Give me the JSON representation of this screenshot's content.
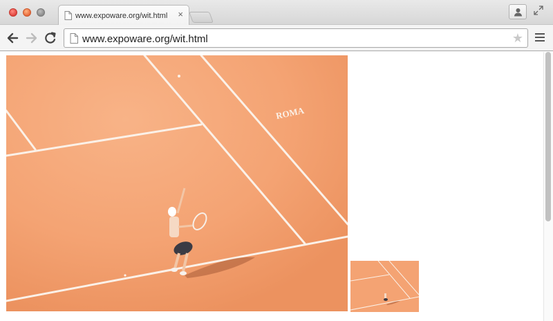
{
  "browser": {
    "tab": {
      "title": "www.expoware.org/wit.html",
      "close_glyph": "×",
      "icon": "document-icon"
    },
    "newtab_icon": "new-tab-icon",
    "profile_icon": "person-icon",
    "fullscreen_icon": "fullscreen-icon"
  },
  "toolbar": {
    "back_icon": "arrow-left-icon",
    "forward_icon": "arrow-right-icon",
    "reload_icon": "reload-icon",
    "address": "www.expoware.org/wit.html",
    "bookmark_glyph": "★",
    "menu_icon": "hamburger-menu-icon"
  },
  "page": {
    "main_image": {
      "subject": "tennis player serving on clay court",
      "court_text": "ROMA"
    },
    "thumbnail": {
      "subject": "tennis player serving on clay court (thumbnail)"
    }
  },
  "colors": {
    "clay": "#f4a373",
    "clay_dark": "#e8895a",
    "line": "#fbf1e8"
  }
}
